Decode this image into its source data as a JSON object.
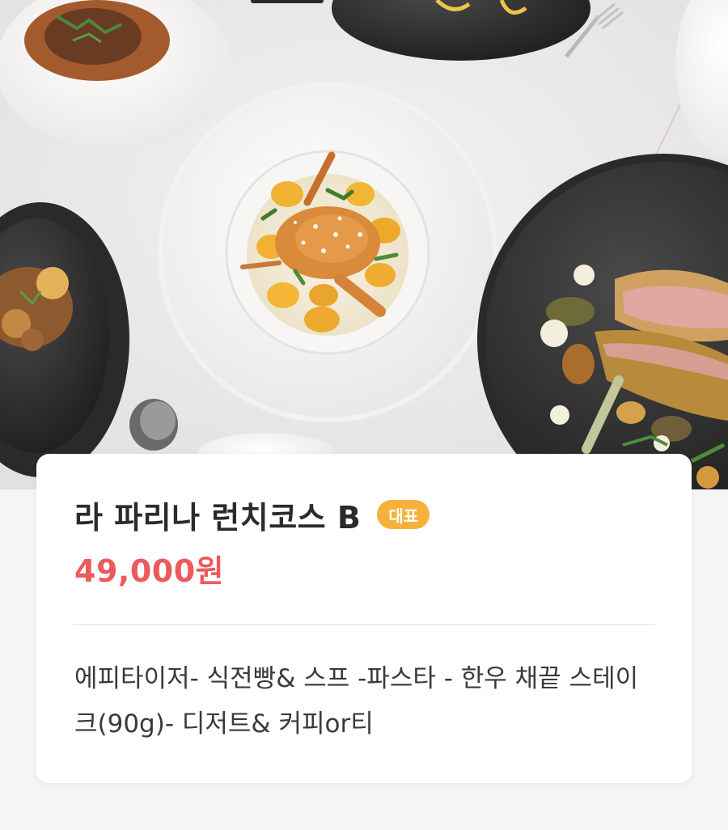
{
  "menu_item": {
    "title": "라 파리나 런치코스 B",
    "badge": "대표",
    "price": "49,000원",
    "description": "에피타이저- 식전빵& 스프 -파스타 - 한우 채끝 스테이크(90g)- 디저트& 커피or티"
  },
  "colors": {
    "badge": "#f6b13c",
    "price": "#ec5a5e",
    "title": "#2b2b2b",
    "description": "#3a3a3a"
  },
  "icons": [
    "food-photo"
  ]
}
